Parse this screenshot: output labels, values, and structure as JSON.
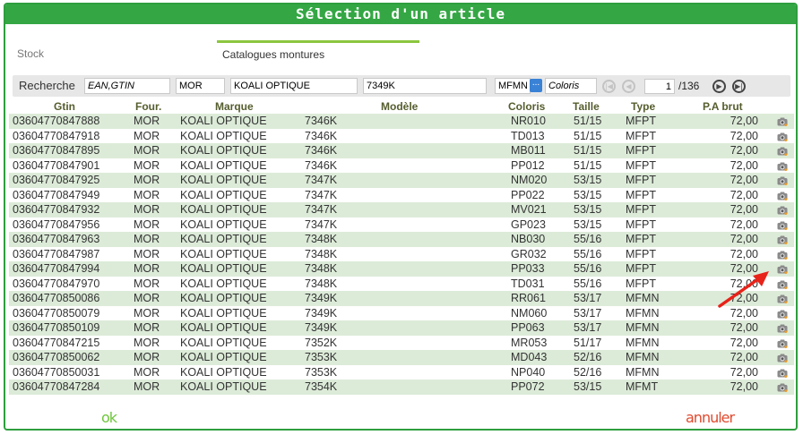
{
  "title": "Sélection d'un article",
  "tabs": [
    {
      "label": "Stock",
      "active": false
    },
    {
      "label": "Catalogues montures",
      "active": true
    }
  ],
  "search": {
    "label": "Recherche",
    "ean_placeholder": "EAN,GTIN",
    "fournisseur": "MOR",
    "marque": "KOALI OPTIQUE",
    "modele": "7349K",
    "type": "MFMN",
    "coloris_placeholder": "Coloris",
    "dots_label": "...",
    "page": "1",
    "page_total": "/136"
  },
  "columns": {
    "gtin": "Gtin",
    "four": "Four.",
    "marque": "Marque",
    "modele": "Modèle",
    "coloris": "Coloris",
    "taille": "Taille",
    "type": "Type",
    "prix": "P.A brut"
  },
  "rows": [
    {
      "gtin": "03604770847888",
      "four": "MOR",
      "marque": "KOALI OPTIQUE",
      "modele": "7346K",
      "coloris": "NR010",
      "taille": "51/15",
      "type": "MFPT",
      "prix": "72,00"
    },
    {
      "gtin": "03604770847918",
      "four": "MOR",
      "marque": "KOALI OPTIQUE",
      "modele": "7346K",
      "coloris": "TD013",
      "taille": "51/15",
      "type": "MFPT",
      "prix": "72,00"
    },
    {
      "gtin": "03604770847895",
      "four": "MOR",
      "marque": "KOALI OPTIQUE",
      "modele": "7346K",
      "coloris": "MB011",
      "taille": "51/15",
      "type": "MFPT",
      "prix": "72,00"
    },
    {
      "gtin": "03604770847901",
      "four": "MOR",
      "marque": "KOALI OPTIQUE",
      "modele": "7346K",
      "coloris": "PP012",
      "taille": "51/15",
      "type": "MFPT",
      "prix": "72,00"
    },
    {
      "gtin": "03604770847925",
      "four": "MOR",
      "marque": "KOALI OPTIQUE",
      "modele": "7347K",
      "coloris": "NM020",
      "taille": "53/15",
      "type": "MFPT",
      "prix": "72,00"
    },
    {
      "gtin": "03604770847949",
      "four": "MOR",
      "marque": "KOALI OPTIQUE",
      "modele": "7347K",
      "coloris": "PP022",
      "taille": "53/15",
      "type": "MFPT",
      "prix": "72,00"
    },
    {
      "gtin": "03604770847932",
      "four": "MOR",
      "marque": "KOALI OPTIQUE",
      "modele": "7347K",
      "coloris": "MV021",
      "taille": "53/15",
      "type": "MFPT",
      "prix": "72,00"
    },
    {
      "gtin": "03604770847956",
      "four": "MOR",
      "marque": "KOALI OPTIQUE",
      "modele": "7347K",
      "coloris": "GP023",
      "taille": "53/15",
      "type": "MFPT",
      "prix": "72,00"
    },
    {
      "gtin": "03604770847963",
      "four": "MOR",
      "marque": "KOALI OPTIQUE",
      "modele": "7348K",
      "coloris": "NB030",
      "taille": "55/16",
      "type": "MFPT",
      "prix": "72,00"
    },
    {
      "gtin": "03604770847987",
      "four": "MOR",
      "marque": "KOALI OPTIQUE",
      "modele": "7348K",
      "coloris": "GR032",
      "taille": "55/16",
      "type": "MFPT",
      "prix": "72,00"
    },
    {
      "gtin": "03604770847994",
      "four": "MOR",
      "marque": "KOALI OPTIQUE",
      "modele": "7348K",
      "coloris": "PP033",
      "taille": "55/16",
      "type": "MFPT",
      "prix": "72,00"
    },
    {
      "gtin": "03604770847970",
      "four": "MOR",
      "marque": "KOALI OPTIQUE",
      "modele": "7348K",
      "coloris": "TD031",
      "taille": "55/16",
      "type": "MFPT",
      "prix": "72,00"
    },
    {
      "gtin": "03604770850086",
      "four": "MOR",
      "marque": "KOALI OPTIQUE",
      "modele": "7349K",
      "coloris": "RR061",
      "taille": "53/17",
      "type": "MFMN",
      "prix": "72,00"
    },
    {
      "gtin": "03604770850079",
      "four": "MOR",
      "marque": "KOALI OPTIQUE",
      "modele": "7349K",
      "coloris": "NM060",
      "taille": "53/17",
      "type": "MFMN",
      "prix": "72,00"
    },
    {
      "gtin": "03604770850109",
      "four": "MOR",
      "marque": "KOALI OPTIQUE",
      "modele": "7349K",
      "coloris": "PP063",
      "taille": "53/17",
      "type": "MFMN",
      "prix": "72,00"
    },
    {
      "gtin": "03604770847215",
      "four": "MOR",
      "marque": "KOALI OPTIQUE",
      "modele": "7352K",
      "coloris": "MR053",
      "taille": "51/17",
      "type": "MFMN",
      "prix": "72,00"
    },
    {
      "gtin": "03604770850062",
      "four": "MOR",
      "marque": "KOALI OPTIQUE",
      "modele": "7353K",
      "coloris": "MD043",
      "taille": "52/16",
      "type": "MFMN",
      "prix": "72,00"
    },
    {
      "gtin": "03604770850031",
      "four": "MOR",
      "marque": "KOALI OPTIQUE",
      "modele": "7353K",
      "coloris": "NP040",
      "taille": "52/16",
      "type": "MFMN",
      "prix": "72,00"
    },
    {
      "gtin": "03604770847284",
      "four": "MOR",
      "marque": "KOALI OPTIQUE",
      "modele": "7354K",
      "coloris": "PP072",
      "taille": "53/15",
      "type": "MFMT",
      "prix": "72,00"
    }
  ],
  "row_icon": "camera-icon",
  "buttons": {
    "ok": "ok",
    "cancel": "annuler"
  },
  "colors": {
    "accent": "#34a744",
    "row_alt": "#dcebd8",
    "ok": "#6ec63c",
    "cancel": "#e04a2e",
    "arrow": "#e8231a"
  }
}
